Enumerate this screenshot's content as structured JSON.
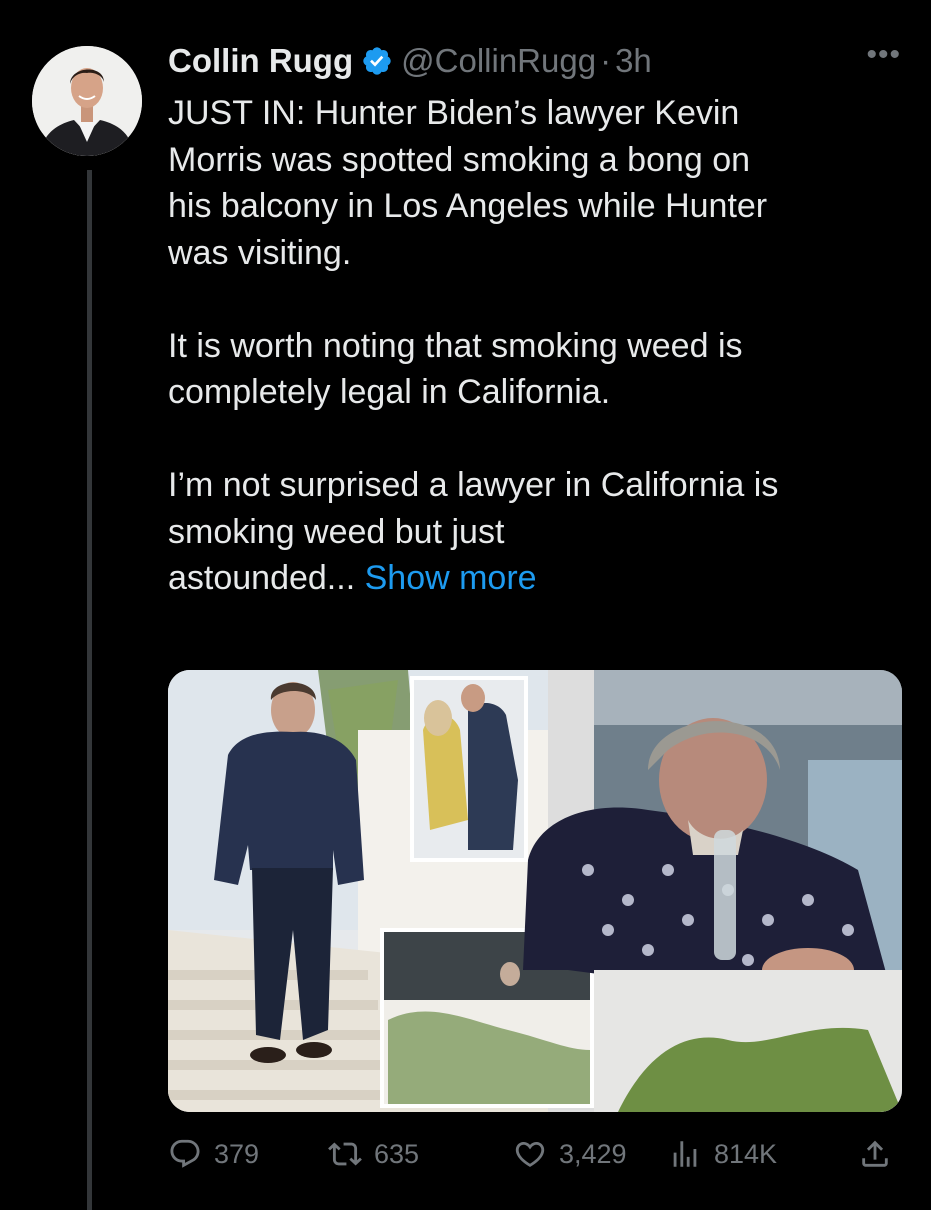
{
  "tweet": {
    "author_name": "Collin Rugg",
    "handle": "@CollinRugg",
    "separator": "·",
    "time": "3h",
    "more_label": "•••",
    "paragraphs": [
      [
        "JUST IN: Hunter Biden’s lawyer Kevin",
        "Morris was spotted smoking a bong on",
        "his balcony in Los Angeles while Hunter",
        "was visiting."
      ],
      [
        "It is worth noting that smoking weed is",
        "completely legal in California."
      ],
      [
        "I’m not surprised a lawyer in California is",
        "smoking weed but just"
      ]
    ],
    "last_line": "astounded...",
    "show_more_label": "Show more",
    "media_alt": "Photo collage of Hunter Biden and lawyer Kevin Morris on a balcony",
    "stats": {
      "replies": "379",
      "retweets": "635",
      "likes": "3,429",
      "views": "814K"
    }
  },
  "icons": {
    "verified": "verified-badge-icon",
    "reply": "reply-icon",
    "retweet": "retweet-icon",
    "like": "heart-icon",
    "views": "views-icon",
    "share": "share-icon"
  },
  "colors": {
    "background": "#000000",
    "text": "#e7e9ea",
    "muted": "#71767b",
    "link": "#1d9bf0",
    "verified": "#1d9bf0"
  }
}
